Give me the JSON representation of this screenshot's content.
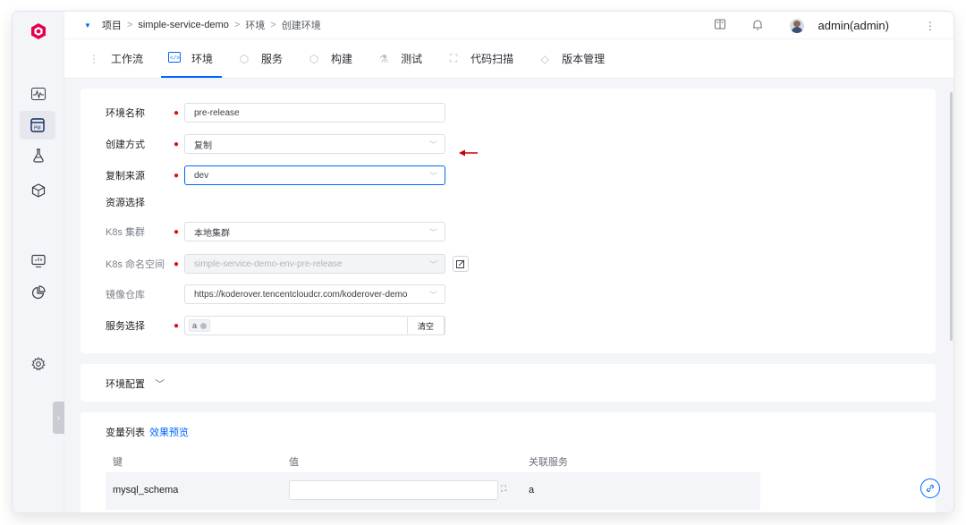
{
  "breadcrumb": {
    "items": [
      "项目",
      "simple-service-demo",
      "环境",
      "创建环境"
    ],
    "sep": ">"
  },
  "user": {
    "name": "admin(admin)"
  },
  "tabs": [
    {
      "label": "工作流",
      "icon": "workflow-icon"
    },
    {
      "label": "环境",
      "icon": "code-env-icon"
    },
    {
      "label": "服务",
      "icon": "service-icon"
    },
    {
      "label": "构建",
      "icon": "build-icon"
    },
    {
      "label": "测试",
      "icon": "flask-icon"
    },
    {
      "label": "代码扫描",
      "icon": "scan-icon"
    },
    {
      "label": "版本管理",
      "icon": "version-icon"
    }
  ],
  "active_tab": "环境",
  "form": {
    "env_name": {
      "label": "环境名称",
      "value": "pre-release"
    },
    "create_method": {
      "label": "创建方式",
      "value": "复制"
    },
    "copy_source": {
      "label": "复制来源",
      "value": "dev"
    },
    "resource_section": "资源选择",
    "k8s_cluster": {
      "label": "K8s 集群",
      "value": "本地集群"
    },
    "k8s_namespace": {
      "label": "K8s 命名空间",
      "value": "simple-service-demo-env-pre-release"
    },
    "image_registry": {
      "label": "镜像仓库",
      "value": "https://koderover.tencentcloudcr.com/koderover-demo"
    },
    "service_select": {
      "label": "服务选择",
      "tag": "a",
      "clear_label": "清空"
    }
  },
  "env_config": {
    "label": "环境配置"
  },
  "variables": {
    "title": "变量列表",
    "preview_link": "效果预览",
    "columns": [
      "键",
      "值",
      "关联服务"
    ],
    "rows": [
      {
        "key": "mysql_schema",
        "value": "",
        "service": "a"
      }
    ]
  },
  "colors": {
    "accent": "#0066ff",
    "required": "#dd1111",
    "arrow": "#cc0000"
  }
}
